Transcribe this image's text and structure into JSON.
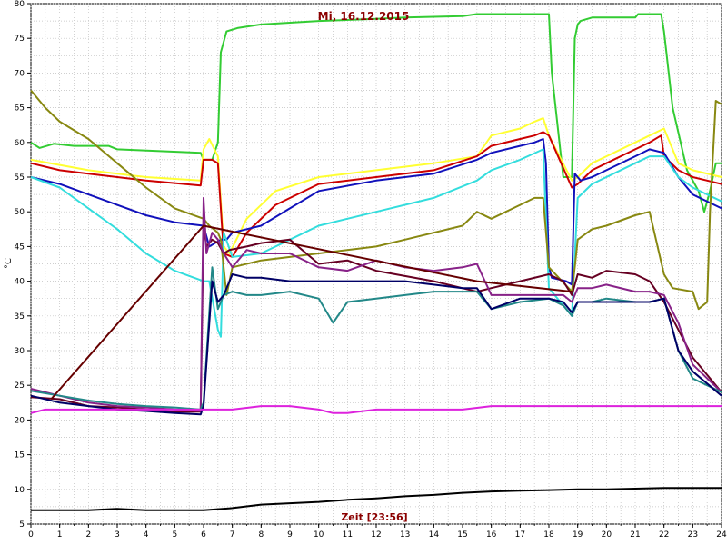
{
  "chart_data": {
    "type": "line",
    "title": "Mi, 16.12.2015",
    "xlabel": "Zeit [23:56]",
    "ylabel": "°C",
    "xlim": [
      0,
      24
    ],
    "ylim": [
      5,
      80
    ],
    "xticks": [
      0,
      1,
      2,
      3,
      4,
      5,
      6,
      7,
      8,
      9,
      10,
      11,
      12,
      13,
      14,
      15,
      16,
      17,
      18,
      19,
      20,
      21,
      22,
      23,
      24
    ],
    "yticks": [
      5,
      10,
      15,
      20,
      25,
      30,
      35,
      40,
      45,
      50,
      55,
      60,
      65,
      70,
      75,
      80
    ],
    "grid": true,
    "series": [
      {
        "color": "#33cc33",
        "x": [
          0,
          0.3,
          0.8,
          1.5,
          2.7,
          3,
          5.9,
          6.0,
          6.3,
          6.5,
          6.6,
          6.8,
          7.2,
          8,
          10,
          12,
          13,
          15,
          15.5,
          16,
          17,
          18.0,
          18.1,
          18.5,
          18.8,
          18.9,
          19.0,
          19.1,
          19.5,
          21,
          21.1,
          21.9,
          22.0,
          22.3,
          22.8,
          23.2,
          23.4,
          23.6,
          23.8,
          24
        ],
        "y": [
          60,
          59.2,
          59.8,
          59.5,
          59.5,
          59,
          58.5,
          57.5,
          57.5,
          60,
          73,
          76,
          76.5,
          77,
          77.5,
          77.8,
          78,
          78.2,
          78.5,
          78.5,
          78.5,
          78.5,
          70,
          55,
          55,
          75,
          77,
          77.5,
          78,
          78,
          78.5,
          78.5,
          76,
          65,
          56,
          53,
          50,
          53,
          57,
          57
        ]
      },
      {
        "color": "#ffff33",
        "x": [
          0,
          2,
          4,
          5.9,
          6,
          6.2,
          6.5,
          6.7,
          6.9,
          7.5,
          8.5,
          10,
          12,
          14,
          15.5,
          16,
          17,
          17.5,
          17.8,
          18,
          18.8,
          19,
          19.5,
          20,
          21,
          21.5,
          22,
          22.5,
          23,
          24
        ],
        "y": [
          57.5,
          56,
          55,
          54.5,
          59,
          60.5,
          58,
          45,
          44,
          49,
          53,
          55,
          56,
          57,
          58,
          61,
          62,
          63,
          63.5,
          61,
          54.5,
          55,
          57,
          58,
          60,
          61,
          62,
          57,
          56,
          55
        ]
      },
      {
        "color": "#cc0000",
        "x": [
          0,
          1,
          2,
          4,
          5.9,
          6,
          6.3,
          6.5,
          6.7,
          7,
          7.5,
          8.5,
          10,
          12,
          14,
          15.5,
          16,
          17,
          17.5,
          17.8,
          18,
          18.8,
          19,
          19.5,
          20,
          21,
          21.5,
          21.9,
          22,
          22.5,
          23,
          23.5,
          24
        ],
        "y": [
          57,
          56,
          55.5,
          54.5,
          53.8,
          57.5,
          57.5,
          57,
          44,
          43.5,
          47,
          51,
          54,
          55,
          56,
          58,
          59.5,
          60.5,
          61,
          61.5,
          61,
          53.5,
          54,
          56,
          57,
          59,
          60,
          61,
          58,
          56,
          55,
          54.5,
          54
        ]
      },
      {
        "color": "#1111bb",
        "x": [
          0,
          1,
          2,
          3,
          4,
          5,
          6,
          6.2,
          6.6,
          6.8,
          7,
          7.5,
          8,
          9,
          10,
          12,
          14,
          15.5,
          16,
          17,
          17.5,
          17.8,
          17.9,
          18.0,
          18.1,
          18.6,
          18.8,
          18.9,
          19.1,
          19.5,
          20,
          21,
          21.5,
          22,
          22.5,
          23,
          24
        ],
        "y": [
          55,
          54,
          52.5,
          51,
          49.5,
          48.5,
          48,
          45,
          46,
          46,
          47,
          47.5,
          48,
          50.5,
          53,
          54.5,
          55.5,
          57.5,
          58.5,
          59.5,
          60,
          60.5,
          57,
          42,
          40.5,
          40,
          39.5,
          55.5,
          54.5,
          55,
          56,
          58,
          59,
          58.5,
          55,
          52.5,
          50.5
        ]
      },
      {
        "color": "#33dddd",
        "x": [
          0,
          1,
          2,
          3,
          4,
          5,
          6,
          6.2,
          6.5,
          6.6,
          6.7,
          7,
          8,
          9,
          10,
          11,
          12,
          14,
          15.5,
          16,
          17,
          17.8,
          18,
          18.8,
          19,
          19.5,
          21,
          21.5,
          22,
          22.5,
          23,
          23.5,
          24
        ],
        "y": [
          55,
          53.5,
          50.5,
          47.5,
          44,
          41.5,
          40,
          40,
          33,
          32,
          47,
          43.5,
          44,
          46,
          48,
          49,
          50,
          52,
          54.5,
          56,
          57.5,
          59,
          39,
          35,
          52,
          54,
          57,
          58,
          58,
          55,
          53.5,
          52.5,
          51.5
        ]
      },
      {
        "color": "#888811",
        "x": [
          0,
          0.5,
          1,
          2,
          3,
          4,
          5,
          6,
          6.2,
          6.5,
          6.6,
          6.8,
          7,
          8,
          10,
          12,
          13,
          15,
          15.5,
          16,
          17,
          17.5,
          17.8,
          18,
          18.8,
          18.9,
          19,
          19.5,
          20,
          21,
          21.5,
          22,
          22.3,
          23,
          23.2,
          23.5,
          23.6,
          23.8,
          24
        ],
        "y": [
          67.5,
          65,
          63,
          60.5,
          57,
          53.5,
          50.5,
          49,
          48,
          47,
          46,
          38,
          42,
          43,
          44,
          45,
          46,
          48,
          50,
          49,
          51,
          52,
          52,
          42,
          38.5,
          42,
          46,
          47.5,
          48,
          49.5,
          50,
          41,
          39,
          38.5,
          36,
          37,
          50,
          66,
          65.5
        ]
      },
      {
        "color": "#660022",
        "x": [
          0,
          1,
          2,
          3,
          4,
          5,
          5.9,
          6,
          6.1,
          6.3,
          6.5,
          6.7,
          6.9,
          7.5,
          8,
          9,
          10,
          11,
          12,
          14,
          15.5,
          16,
          17,
          18,
          18.5,
          18.8,
          19,
          19.5,
          20,
          21,
          21.5,
          22,
          22.5,
          23,
          24
        ],
        "y": [
          23.3,
          23,
          22,
          21.8,
          21.5,
          21.2,
          21.2,
          48,
          45,
          46,
          45.5,
          44,
          44.5,
          45,
          45.5,
          46,
          42.5,
          43,
          41.5,
          40,
          38.5,
          39,
          40,
          41,
          40,
          38,
          41,
          40.5,
          41.5,
          41,
          40,
          37,
          33,
          29,
          24
        ]
      },
      {
        "color": "#882288",
        "x": [
          0,
          1,
          2,
          3,
          4,
          5,
          5.9,
          6,
          6.1,
          6.3,
          6.5,
          6.7,
          7,
          7.5,
          8,
          9,
          10,
          11,
          12,
          13,
          14,
          15,
          15.5,
          16,
          17,
          18,
          18.5,
          18.8,
          19,
          19.5,
          20,
          21,
          21.5,
          22,
          22.5,
          23,
          24
        ],
        "y": [
          24.5,
          23.5,
          22.5,
          22,
          21.8,
          21.5,
          21.3,
          52,
          44,
          47,
          46,
          44,
          42,
          44.5,
          44,
          44,
          42,
          41.5,
          43,
          42,
          41.5,
          42,
          42.5,
          38,
          38,
          38,
          38,
          37,
          39,
          39,
          39.5,
          38.5,
          38.5,
          38,
          34,
          28,
          24
        ]
      },
      {
        "color": "#228888",
        "x": [
          0,
          1,
          2,
          3,
          4,
          5,
          5.9,
          6,
          6.3,
          6.5,
          6.7,
          7,
          7.5,
          8,
          9,
          10,
          10.5,
          11,
          12,
          13,
          14,
          15,
          15.5,
          16,
          17,
          18,
          18.5,
          18.8,
          19,
          19.5,
          20,
          21,
          21.5,
          22,
          22.5,
          23,
          24
        ],
        "y": [
          24.2,
          23.5,
          22.8,
          22.3,
          22,
          21.8,
          21.5,
          22.5,
          42,
          36,
          38,
          38.5,
          38,
          38,
          38.5,
          37.5,
          34,
          37,
          37.5,
          38,
          38.5,
          38.5,
          38.5,
          36,
          37,
          37.5,
          36.5,
          35,
          37,
          37,
          37.5,
          37,
          37,
          37.5,
          30,
          26,
          24
        ]
      },
      {
        "color": "#000066",
        "x": [
          0,
          1,
          2,
          3,
          4,
          5,
          5.9,
          6,
          6.3,
          6.5,
          6.7,
          7,
          7.5,
          8,
          9,
          10,
          11,
          12,
          13,
          14,
          15,
          15.5,
          16,
          17,
          18,
          18.5,
          18.8,
          19,
          19.5,
          20,
          21,
          21.5,
          22,
          22.5,
          23,
          24
        ],
        "y": [
          23.5,
          22.5,
          22,
          21.5,
          21.3,
          21,
          20.8,
          22,
          40,
          37,
          38,
          41,
          40.5,
          40.5,
          40,
          40,
          40,
          40,
          40,
          39.5,
          39,
          39,
          36,
          37.5,
          37.5,
          37,
          35.5,
          37,
          37,
          37,
          37,
          37,
          37.5,
          30,
          27,
          23.5
        ]
      },
      {
        "color": "#dd22dd",
        "x": [
          0,
          0.5,
          1,
          2,
          3,
          4,
          5,
          6,
          7,
          8,
          9,
          10,
          10.5,
          11,
          12,
          13,
          14,
          15,
          16,
          17,
          18,
          19,
          20,
          21,
          22,
          23,
          24
        ],
        "y": [
          21,
          21.5,
          21.5,
          21.5,
          21.5,
          21.5,
          21.5,
          21.5,
          21.5,
          22,
          22,
          21.5,
          21,
          21,
          21.5,
          21.5,
          21.5,
          21.5,
          22,
          22,
          22,
          22,
          22,
          22,
          22,
          22,
          22
        ]
      },
      {
        "color": "#000000",
        "x": [
          0,
          1,
          2,
          3,
          4,
          5,
          6,
          7,
          8,
          9,
          10,
          11,
          12,
          13,
          14,
          15,
          16,
          17,
          18,
          19,
          20,
          21,
          22,
          23,
          24
        ],
        "y": [
          7,
          7,
          7,
          7.2,
          7,
          7,
          7,
          7.3,
          7.8,
          8,
          8.2,
          8.5,
          8.7,
          9,
          9.2,
          9.5,
          9.7,
          9.8,
          9.9,
          10,
          10,
          10.1,
          10.2,
          10.2,
          10.2
        ]
      },
      {
        "color": "#660000",
        "x": [
          0.7,
          6.0,
          15.5,
          18.8
        ],
        "y": [
          23,
          48,
          40,
          38.5
        ]
      }
    ]
  }
}
